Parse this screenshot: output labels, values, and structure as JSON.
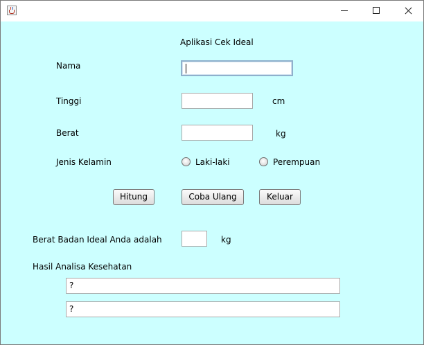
{
  "window": {
    "title": "",
    "app_icon": "java-cup-icon",
    "controls": {
      "minimize": "minimize-icon",
      "maximize": "maximize-icon",
      "close": "close-icon"
    }
  },
  "form": {
    "heading": "Aplikasi Cek Ideal",
    "nama": {
      "label": "Nama",
      "value": ""
    },
    "tinggi": {
      "label": "Tinggi",
      "value": "",
      "unit": "cm"
    },
    "berat": {
      "label": "Berat",
      "value": "",
      "unit": "kg"
    },
    "jenis_kelamin": {
      "label": "Jenis Kelamin",
      "options": [
        {
          "label": "Laki-laki",
          "selected": false
        },
        {
          "label": "Perempuan",
          "selected": false
        }
      ]
    },
    "buttons": {
      "hitung": "Hitung",
      "coba_ulang": "Coba Ulang",
      "keluar": "Keluar"
    },
    "hasil": {
      "ideal_label": "Berat Badan Ideal Anda adalah",
      "ideal_value": "",
      "ideal_unit": "kg",
      "analisa_label": "Hasil Analisa Kesehatan",
      "analisa_line1": "?",
      "analisa_line2": "?"
    }
  },
  "colors": {
    "background": "#ccffff",
    "titlebar": "#ffffff",
    "focus_border": "#8fb0cc"
  }
}
